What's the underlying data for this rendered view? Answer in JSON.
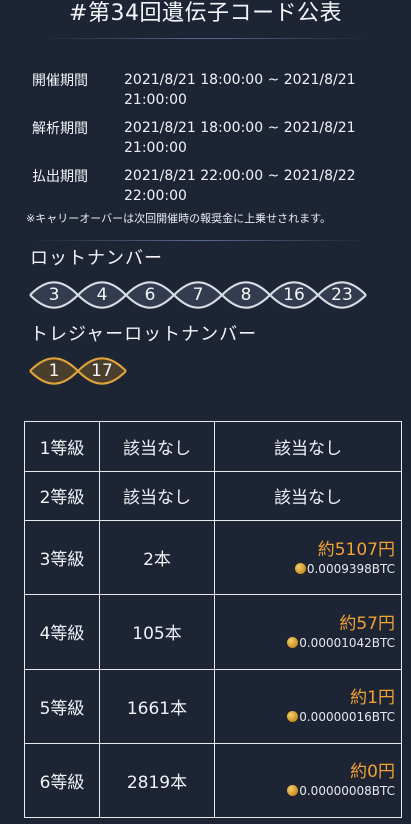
{
  "title": "#第34回遺伝子コード公表",
  "periods": [
    {
      "label": "開催期間",
      "line1": "2021/8/21 18:00:00 ~ 2021/8/21",
      "line2": "21:00:00"
    },
    {
      "label": "解析期間",
      "line1": "2021/8/21 18:00:00 ~ 2021/8/21",
      "line2": "21:00:00"
    },
    {
      "label": "払出期間",
      "line1": "2021/8/21 22:00:00 ~ 2021/8/22",
      "line2": "22:00:00"
    }
  ],
  "note": "※キャリーオーバーは次回開催時の報奨金に上乗せされます。",
  "lot": {
    "label": "ロットナンバー",
    "numbers": [
      "3",
      "4",
      "6",
      "7",
      "8",
      "16",
      "23"
    ]
  },
  "treasure": {
    "label": "トレジャーロットナンバー",
    "numbers": [
      "1",
      "17"
    ]
  },
  "prizes": [
    {
      "grade": "1等級",
      "count": "該当なし",
      "prize": "該当なし"
    },
    {
      "grade": "2等級",
      "count": "該当なし",
      "prize": "該当なし"
    },
    {
      "grade": "3等級",
      "count": "2本",
      "yen": "約5107円",
      "btc": "0.0009398BTC"
    },
    {
      "grade": "4等級",
      "count": "105本",
      "yen": "約57円",
      "btc": "0.00001042BTC"
    },
    {
      "grade": "5等級",
      "count": "1661本",
      "yen": "約1円",
      "btc": "0.00000016BTC"
    },
    {
      "grade": "6等級",
      "count": "2819本",
      "yen": "約0円",
      "btc": "0.00000008BTC"
    }
  ],
  "colors": {
    "background": "#1d2433",
    "accent_yen": "#f0a233",
    "helix_silver": "#d8dbe2",
    "helix_gold": "#e0a33a"
  },
  "icons": {
    "btc": "bitcoin-coin-icon"
  }
}
